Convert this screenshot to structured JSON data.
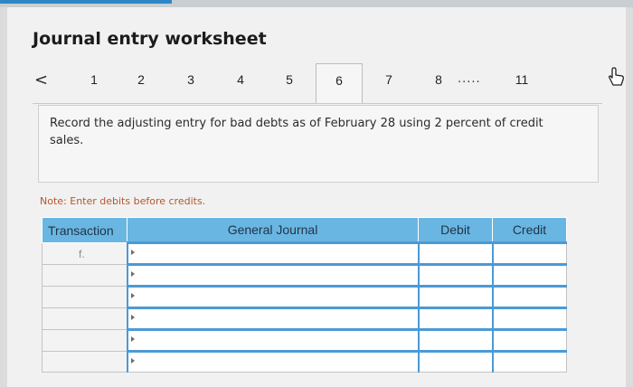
{
  "title": "Journal entry worksheet",
  "navigation": {
    "prev_glyph": "<",
    "tabs": [
      "1",
      "2",
      "3",
      "4",
      "5",
      "6",
      "7",
      "8",
      "11"
    ],
    "active_tab": "6",
    "ellipsis": "....."
  },
  "instruction": "Record the adjusting entry for bad debts as of February 28 using 2 percent of credit sales.",
  "note": "Note: Enter debits before credits.",
  "table": {
    "headers": {
      "transaction": "Transaction",
      "general_journal": "General Journal",
      "debit": "Debit",
      "credit": "Credit"
    },
    "rows": [
      {
        "transaction": "f."
      },
      {
        "transaction": ""
      },
      {
        "transaction": ""
      },
      {
        "transaction": ""
      },
      {
        "transaction": ""
      },
      {
        "transaction": ""
      }
    ]
  },
  "icons": {
    "cursor": "hand-pointer-icon",
    "previous": "chevron-left-icon"
  }
}
